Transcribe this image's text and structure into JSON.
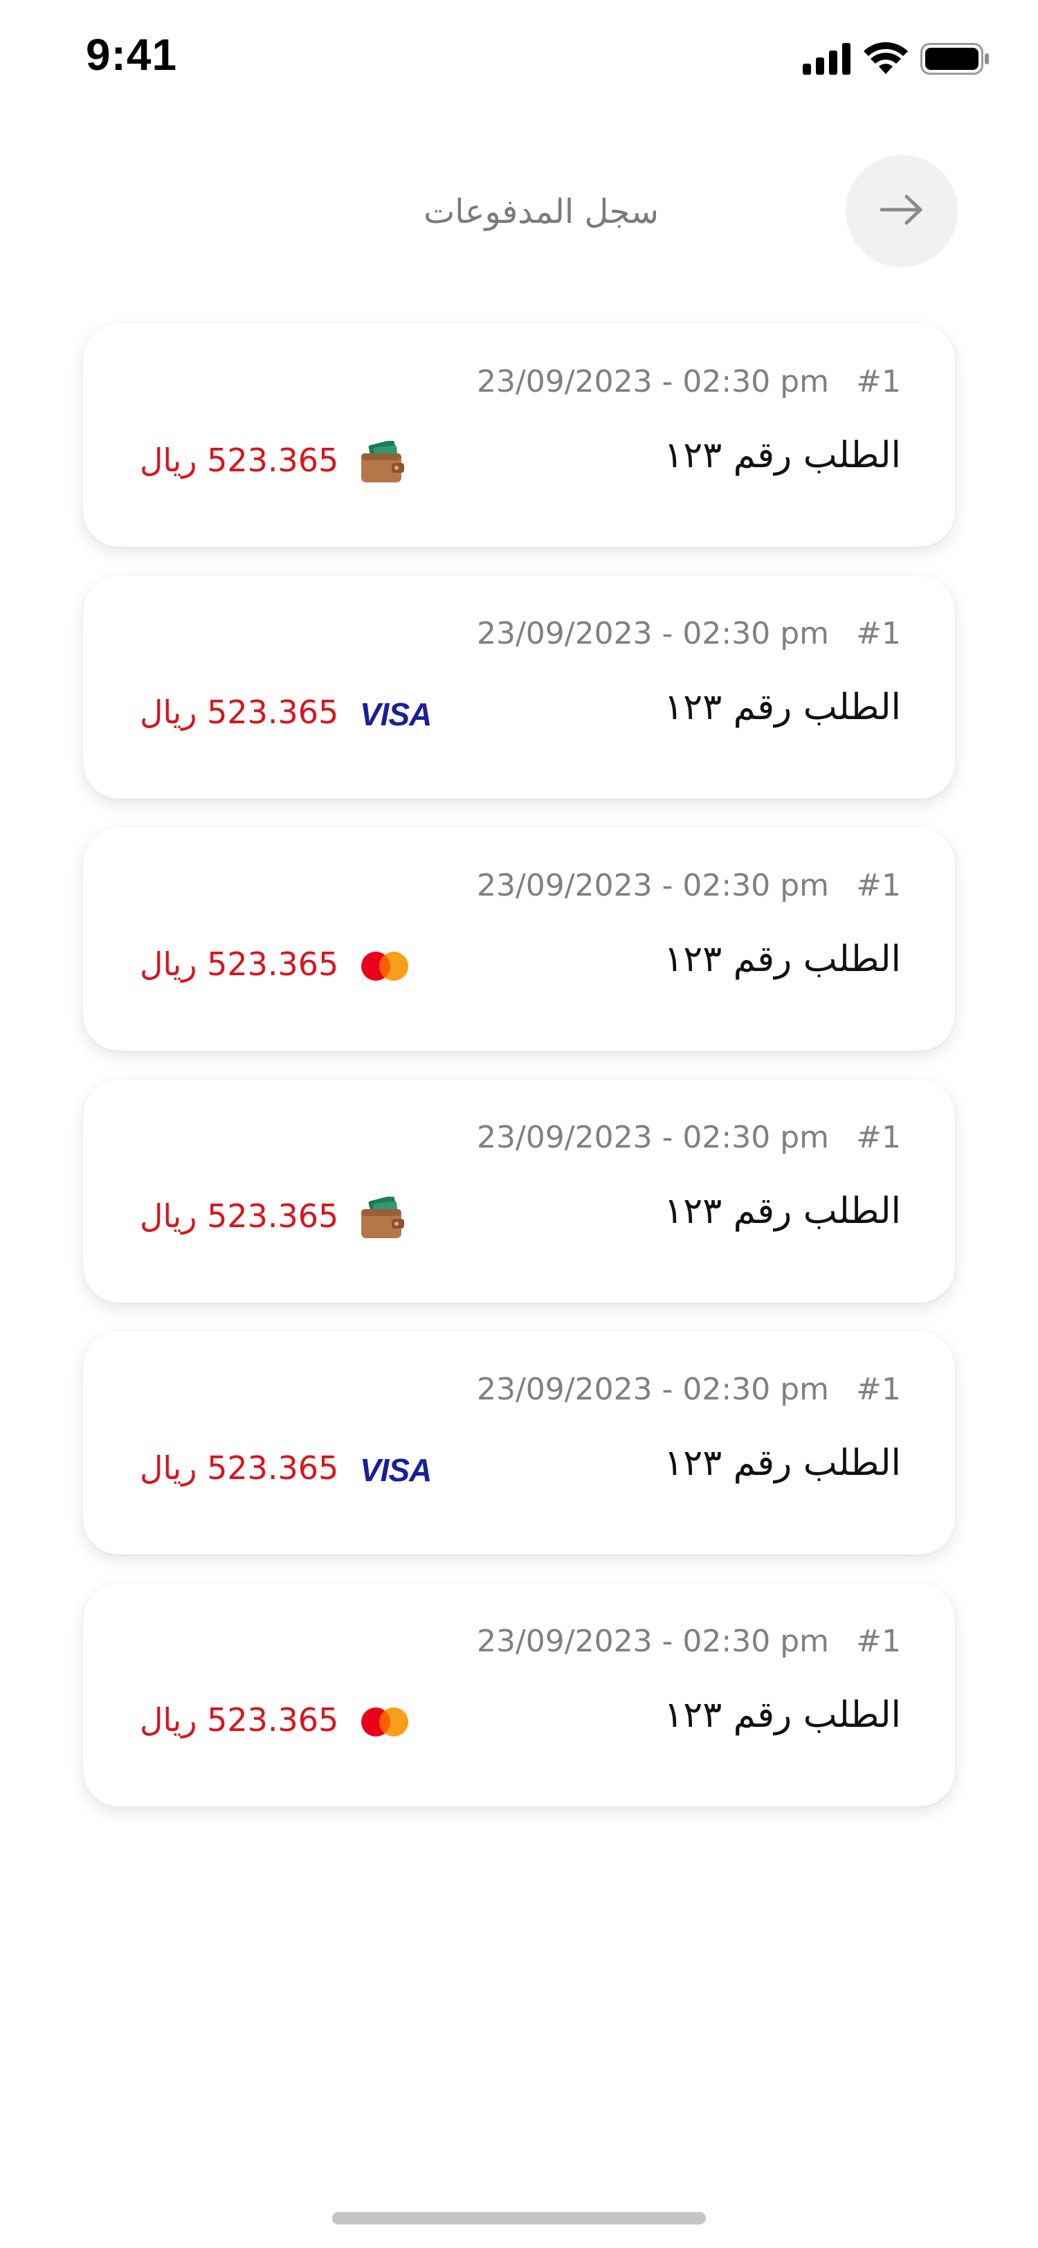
{
  "status_bar": {
    "time": "9:41"
  },
  "header": {
    "title": "سجل المدفوعات",
    "back_icon": "arrow-right-icon"
  },
  "colors": {
    "amount": "#d9141b",
    "muted": "#808080",
    "visa_blue": "#1a1f9e",
    "mastercard_red": "#eb001b",
    "mastercard_orange": "#f79e1b",
    "wallet_brown": "#b5764a",
    "wallet_green": "#1e7a5a"
  },
  "payments": [
    {
      "number": "#1",
      "date": "23/09/2023 - 02:30 pm",
      "order": "الطلب رقم ١٢٣",
      "amount": "523.365 ريال",
      "method": "wallet"
    },
    {
      "number": "#1",
      "date": "23/09/2023 - 02:30 pm",
      "order": "الطلب رقم ١٢٣",
      "amount": "523.365 ريال",
      "method": "visa"
    },
    {
      "number": "#1",
      "date": "23/09/2023 - 02:30 pm",
      "order": "الطلب رقم ١٢٣",
      "amount": "523.365 ريال",
      "method": "mastercard"
    },
    {
      "number": "#1",
      "date": "23/09/2023 - 02:30 pm",
      "order": "الطلب رقم ١٢٣",
      "amount": "523.365 ريال",
      "method": "wallet"
    },
    {
      "number": "#1",
      "date": "23/09/2023 - 02:30 pm",
      "order": "الطلب رقم ١٢٣",
      "amount": "523.365 ريال",
      "method": "visa"
    },
    {
      "number": "#1",
      "date": "23/09/2023 - 02:30 pm",
      "order": "الطلب رقم ١٢٣",
      "amount": "523.365 ريال",
      "method": "mastercard"
    }
  ],
  "visa_label": "VISA"
}
